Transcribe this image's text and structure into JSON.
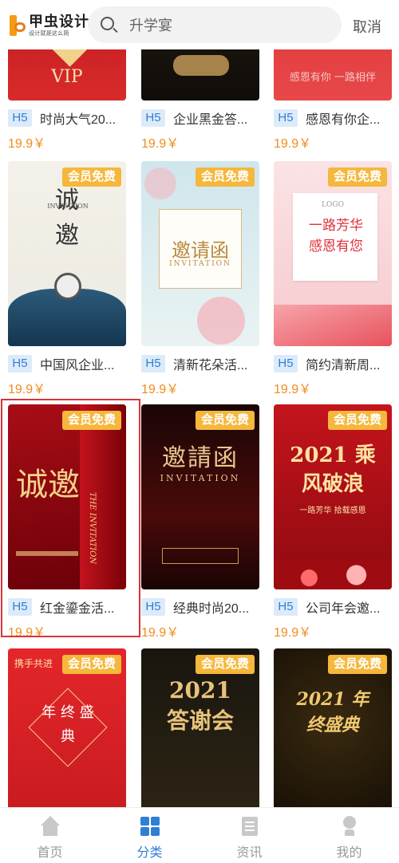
{
  "header": {
    "logo_main": "甲虫设计",
    "logo_sub": "设计就是这么简",
    "search_placeholder": "升学宴",
    "cancel_label": "取消"
  },
  "cards": [
    {
      "tag": "H5",
      "title": "时尚大气20...",
      "price": "19.9￥",
      "badge": "",
      "poster_text": "VIP"
    },
    {
      "tag": "H5",
      "title": "企业黑金答...",
      "price": "19.9￥",
      "badge": "",
      "poster_text": ""
    },
    {
      "tag": "H5",
      "title": "感恩有你企...",
      "price": "19.9￥",
      "badge": "",
      "poster_text": "感恩有你 一路相伴"
    },
    {
      "tag": "H5",
      "title": "中国风企业...",
      "price": "19.9￥",
      "badge": "会员免费",
      "poster_text": "诚 邀",
      "poster_sub": "INVITATION"
    },
    {
      "tag": "H5",
      "title": "清新花朵活...",
      "price": "19.9￥",
      "badge": "会员免费",
      "poster_text": "邀请函",
      "poster_sub": "INVITATION"
    },
    {
      "tag": "H5",
      "title": "简约清新周...",
      "price": "19.9￥",
      "badge": "会员免费",
      "poster_text": "一路芳华 感恩有您",
      "poster_sub": "LOGO"
    },
    {
      "tag": "H5",
      "title": "红金鎏金活...",
      "price": "19.9￥",
      "badge": "会员免费",
      "poster_text": "诚邀",
      "poster_sub": "THE INVITATION"
    },
    {
      "tag": "H5",
      "title": "经典时尚20...",
      "price": "19.9￥",
      "badge": "会员免费",
      "poster_text": "邀請函",
      "poster_sub": "INVITATION"
    },
    {
      "tag": "H5",
      "title": "公司年会邀...",
      "price": "19.9￥",
      "badge": "会员免费",
      "poster_text": "2021 乘风破浪",
      "poster_sub": "一路芳华 拾载感恩"
    },
    {
      "tag": "",
      "title": "",
      "price": "",
      "badge": "会员免费",
      "poster_text": "年 终 盛 典",
      "poster_sub": "携手共进"
    },
    {
      "tag": "",
      "title": "",
      "price": "",
      "badge": "会员免费",
      "poster_text": "2021 答谢会",
      "poster_sub": ""
    },
    {
      "tag": "",
      "title": "",
      "price": "",
      "badge": "会员免费",
      "poster_text": "2021 年终盛典",
      "poster_sub": ""
    }
  ],
  "nav": [
    {
      "label": "首页",
      "icon": "home-icon"
    },
    {
      "label": "分类",
      "icon": "category-icon",
      "active": true
    },
    {
      "label": "资讯",
      "icon": "news-icon"
    },
    {
      "label": "我的",
      "icon": "profile-icon"
    }
  ],
  "colors": {
    "accent": "#2f7fd3",
    "price": "#f08c1a",
    "badge": "#f5b73c",
    "selection": "#d8343a"
  }
}
